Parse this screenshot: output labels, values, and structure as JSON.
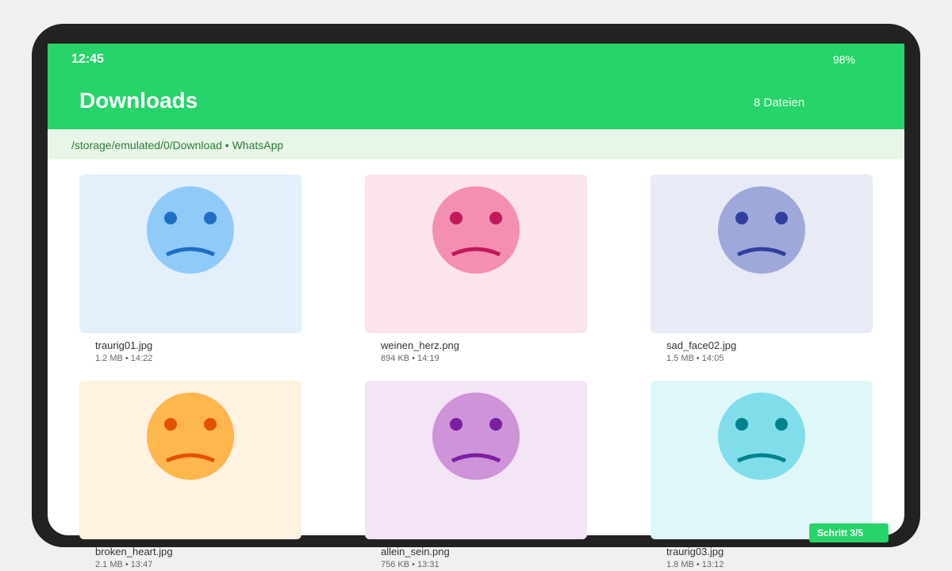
{
  "status": {
    "time": "12:45",
    "battery": "98%"
  },
  "header": {
    "title": "Downloads",
    "file_count": "8 Dateien"
  },
  "path": "/storage/emulated/0/Download • WhatsApp",
  "files": [
    {
      "name": "traurig01.jpg",
      "meta": "1.2 MB • 14:22",
      "bg": "#e3f0fc",
      "face": "#90caf9",
      "feature": "#1e6fc4"
    },
    {
      "name": "weinen_herz.png",
      "meta": "894 KB • 14:19",
      "bg": "#fce4ec",
      "face": "#f48fb1",
      "feature": "#c2185b"
    },
    {
      "name": "sad_face02.jpg",
      "meta": "1.5 MB • 14:05",
      "bg": "#e8eaf6",
      "face": "#9fa8da",
      "feature": "#303f9f"
    },
    {
      "name": "broken_heart.jpg",
      "meta": "2.1 MB • 13:47",
      "bg": "#fff2e0",
      "face": "#ffb74d",
      "feature": "#e65100"
    },
    {
      "name": "allein_sein.png",
      "meta": "756 KB • 13:31",
      "bg": "#f3e5f5",
      "face": "#ce93d8",
      "feature": "#7b1fa2"
    },
    {
      "name": "traurig03.jpg",
      "meta": "1.8 MB • 13:12",
      "bg": "#e0f7fa",
      "face": "#80deea",
      "feature": "#00838f"
    }
  ],
  "step_badge": "Schritt 3/5",
  "colors": {
    "accent": "#27d469",
    "path_bg": "#e8f5e9",
    "path_text": "#2e7d32"
  }
}
